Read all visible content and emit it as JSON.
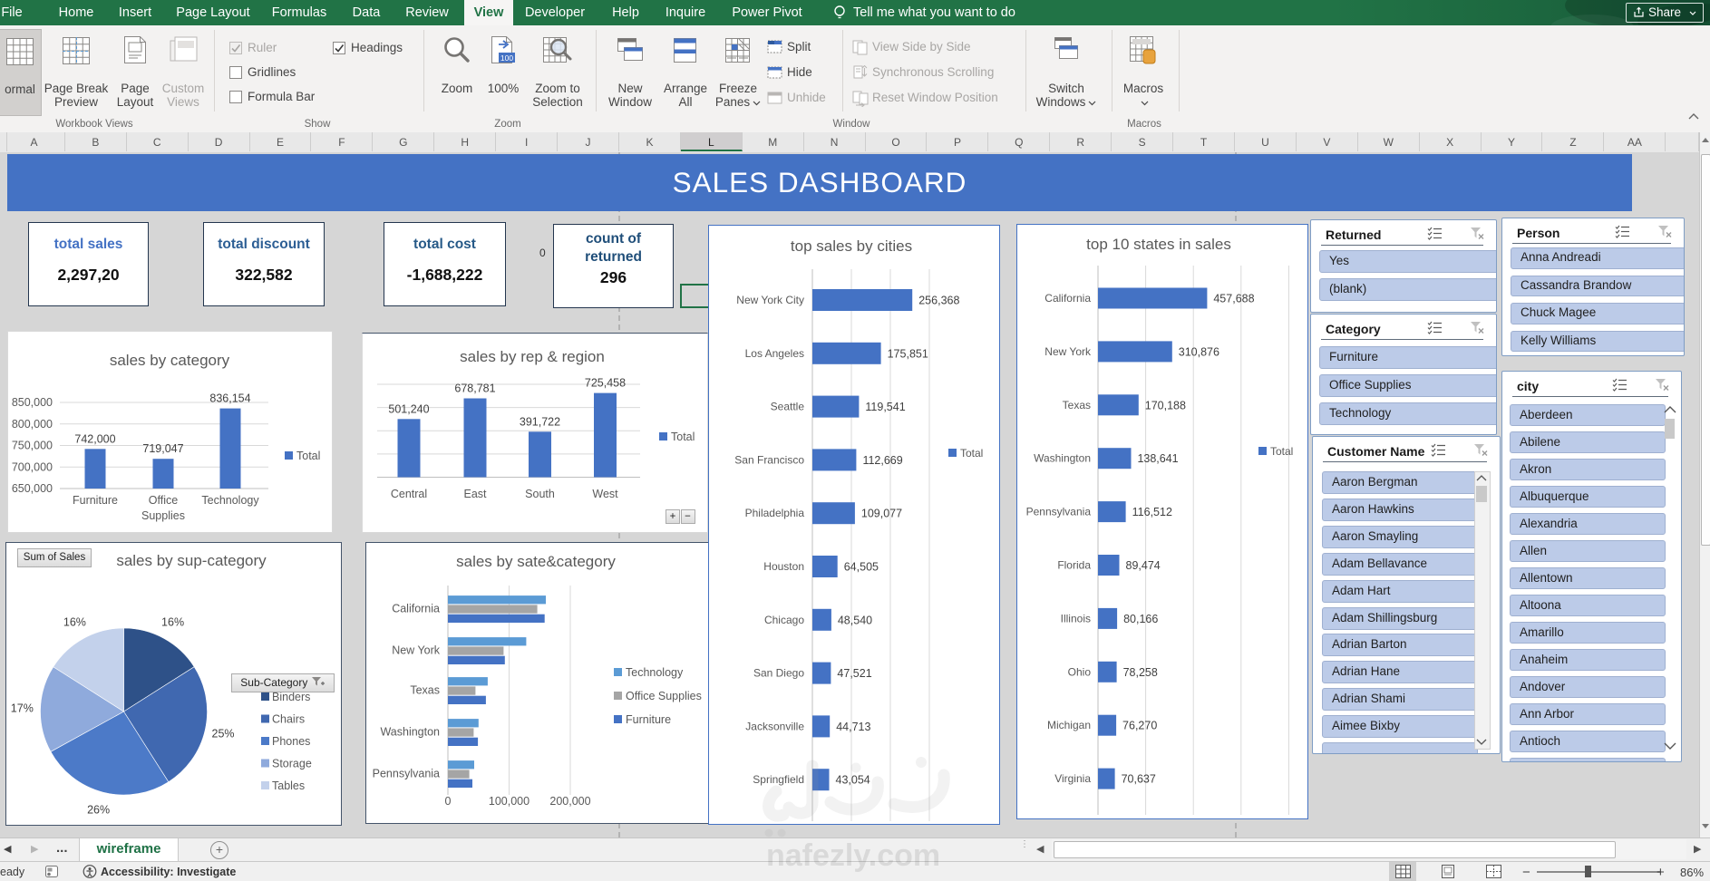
{
  "window": {
    "share": "Share",
    "tell_me": "Tell me what you want to do"
  },
  "ribbon": {
    "tabs": [
      "File",
      "Home",
      "Insert",
      "Page Layout",
      "Formulas",
      "Data",
      "Review",
      "View",
      "Developer",
      "Help",
      "Inquire",
      "Power Pivot"
    ],
    "active_tab": "View",
    "workbook_views": {
      "group": "Workbook Views",
      "normal": "ormal",
      "page_break_preview": "Page Break Preview",
      "page_layout": "Page Layout",
      "custom_views": "Custom Views"
    },
    "show": {
      "group": "Show",
      "ruler": "Ruler",
      "gridlines": "Gridlines",
      "formula_bar": "Formula Bar",
      "headings": "Headings",
      "ruler_checked": true,
      "gridlines_checked": false,
      "formula_bar_checked": false,
      "headings_checked": true
    },
    "zoom": {
      "group": "Zoom",
      "zoom": "Zoom",
      "hundred": "100%",
      "zoom_to_selection": "Zoom to Selection"
    },
    "window_group": {
      "group": "Window",
      "new_window": "New Window",
      "arrange_all": "Arrange All",
      "freeze_panes": "Freeze Panes",
      "split": "Split",
      "hide": "Hide",
      "unhide": "Unhide",
      "view_side_by_side": "View Side by Side",
      "synchronous_scrolling": "Synchronous Scrolling",
      "reset_window_position": "Reset Window Position",
      "switch_windows": "Switch Windows"
    },
    "macros_group": {
      "group": "Macros",
      "macros": "Macros"
    }
  },
  "columns": {
    "letters": [
      "A",
      "B",
      "C",
      "D",
      "E",
      "F",
      "G",
      "H",
      "I",
      "J",
      "K",
      "L",
      "M",
      "N",
      "O",
      "P",
      "Q",
      "R",
      "S",
      "T",
      "U",
      "V",
      "W",
      "X",
      "Y",
      "Z",
      "AA"
    ],
    "selected": "L"
  },
  "banner": {
    "title": "SALES DASHBOARD",
    "color": "#4472c4"
  },
  "kpis": [
    {
      "title": "total sales",
      "value": "2,297,20",
      "title_color": "#4472c4"
    },
    {
      "title": "total discount",
      "value": "322,582",
      "title_color": "#2c5e94"
    },
    {
      "title": "total cost",
      "value": "-1,688,222",
      "title_color": "#275a88"
    },
    {
      "title": "count of returned",
      "value": "296",
      "title_color": "#1f4e79"
    }
  ],
  "stray_cell_value": "0",
  "chart_data": [
    {
      "id": "sales_by_category",
      "type": "bar",
      "title": "sales by category",
      "categories": [
        "Furniture",
        "Office Supplies",
        "Technology"
      ],
      "values": [
        742000,
        719047,
        836154
      ],
      "data_labels": [
        "742,000",
        "719,047",
        "836,154"
      ],
      "ytick_labels": [
        "650,000",
        "700,000",
        "750,000",
        "800,000",
        "850,000"
      ],
      "ylim": [
        650000,
        850000
      ],
      "grid_step": 50000,
      "legend": [
        "Total"
      ],
      "bar_color": "#4472c4",
      "grid_on": true,
      "legend_position": "right"
    },
    {
      "id": "sales_by_rep_region",
      "type": "bar",
      "title": "sales by rep & region",
      "categories": [
        "Central",
        "East",
        "South",
        "West"
      ],
      "values": [
        501240,
        678781,
        391722,
        725458
      ],
      "data_labels": [
        "501,240",
        "678,781",
        "391,722",
        "725,458"
      ],
      "ytick_labels": [],
      "ylim": [
        0,
        1000000
      ],
      "grid_step": 200000,
      "legend": [
        "Total"
      ],
      "bar_color": "#4472c4",
      "grid_on": true,
      "legend_position": "right",
      "pivot_buttons": [
        "+",
        "−"
      ]
    },
    {
      "id": "sales_by_sup_category",
      "type": "pie",
      "title": "sales by sup-category",
      "pivot_field_button": "Sum of Sales",
      "filter_button": "Sub-Category",
      "slices": [
        {
          "name": "Binders",
          "pct": 16,
          "label": "16%",
          "color": "#2e5188"
        },
        {
          "name": "Chairs",
          "pct": 25,
          "label": "25%",
          "color": "#4068b0"
        },
        {
          "name": "Phones",
          "pct": 26,
          "label": "26%",
          "color": "#4c7ac8"
        },
        {
          "name": "Storage",
          "pct": 17,
          "label": "17%",
          "color": "#8faadc"
        },
        {
          "name": "Tables",
          "pct": 16,
          "label": "16%",
          "color": "#c3d1eb"
        }
      ],
      "legend_position": "right"
    },
    {
      "id": "sales_by_state_category",
      "type": "hbar-multi",
      "title": "sales by sate&category",
      "categories": [
        "California",
        "New York",
        "Texas",
        "Washington",
        "Pennsylvania"
      ],
      "series": [
        {
          "name": "Technology",
          "color": "#5b9bd5",
          "values": [
            160000,
            128000,
            65000,
            50000,
            43000
          ]
        },
        {
          "name": "Office Supplies",
          "color": "#a5a5a5",
          "values": [
            146000,
            91000,
            45000,
            42000,
            35000
          ]
        },
        {
          "name": "Furniture",
          "color": "#4472c4",
          "values": [
            158000,
            93000,
            62000,
            49000,
            40000
          ]
        }
      ],
      "xtick_labels": [
        "0",
        "100,000",
        "200,000"
      ],
      "xtick_values": [
        0,
        100000,
        200000
      ],
      "grid_on": true,
      "legend_position": "right"
    },
    {
      "id": "top_sales_by_cities",
      "type": "hbar",
      "title": "top sales  by cities",
      "categories": [
        "New York City",
        "Los Angeles",
        "Seattle",
        "San Francisco",
        "Philadelphia",
        "Houston",
        "Chicago",
        "San Diego",
        "Jacksonville",
        "Springfield"
      ],
      "values": [
        256368,
        175851,
        119541,
        112669,
        109077,
        64505,
        48540,
        47521,
        44713,
        43054
      ],
      "data_labels": [
        "256,368",
        "175,851",
        "119,541",
        "112,669",
        "109,077",
        "64,505",
        "48,540",
        "47,521",
        "44,713",
        "43,054"
      ],
      "grid_step": 100000,
      "grid_max": 300000,
      "xlim": [
        0,
        480000
      ],
      "legend": [
        "Total"
      ],
      "bar_color": "#4472c4",
      "grid_on": true,
      "legend_position": "right"
    },
    {
      "id": "top_10_states_in_sales",
      "type": "hbar",
      "title": "top 10 states in sales",
      "categories": [
        "California",
        "New York",
        "Texas",
        "Washington",
        "Pennsylvania",
        "Florida",
        "Illinois",
        "Ohio",
        "Michigan",
        "Virginia"
      ],
      "values": [
        457688,
        310876,
        170188,
        138641,
        116512,
        89474,
        80166,
        78258,
        76270,
        70637
      ],
      "data_labels": [
        "457,688",
        "310,876",
        "170,188",
        "138,641",
        "116,512",
        "89,474",
        "80,166",
        "78,258",
        "76,270",
        "70,637"
      ],
      "grid_step": 200000,
      "grid_max": 800000,
      "xlim": [
        0,
        860000
      ],
      "legend": [
        "Total"
      ],
      "bar_color": "#4472c4",
      "grid_on": true,
      "legend_position": "right"
    }
  ],
  "slicers": [
    {
      "title": "Returned",
      "items": [
        "Yes",
        "(blank)"
      ],
      "scrollbar": false
    },
    {
      "title": "Category",
      "items": [
        "Furniture",
        "Office Supplies",
        "Technology"
      ],
      "scrollbar": false
    },
    {
      "title": "Customer Name",
      "items": [
        "Aaron Bergman",
        "Aaron Hawkins",
        "Aaron Smayling",
        "Adam Bellavance",
        "Adam Hart",
        "Adam Shillingsburg",
        "Adrian Barton",
        "Adrian Hane",
        "Adrian Shami",
        "Aimee Bixby"
      ],
      "scrollbar": true
    },
    {
      "title": "Person",
      "items": [
        "Anna Andreadi",
        "Cassandra Brandow",
        "Chuck Magee",
        "Kelly Williams"
      ],
      "scrollbar": false
    },
    {
      "title": "city",
      "items": [
        "Aberdeen",
        "Abilene",
        "Akron",
        "Albuquerque",
        "Alexandria",
        "Allen",
        "Allentown",
        "Altoona",
        "Amarillo",
        "Anaheim",
        "Andover",
        "Ann Arbor",
        "Antioch"
      ],
      "scrollbar": true
    }
  ],
  "sheet_tabs": {
    "ellipsis": "...",
    "active_tab": "wireframe"
  },
  "status_bar": {
    "ready": "eady",
    "accessibility": "Accessibility: Investigate",
    "zoom_level": "86%"
  },
  "watermark": {
    "arabic": "نف خلي",
    "site": "nafezly.com"
  }
}
